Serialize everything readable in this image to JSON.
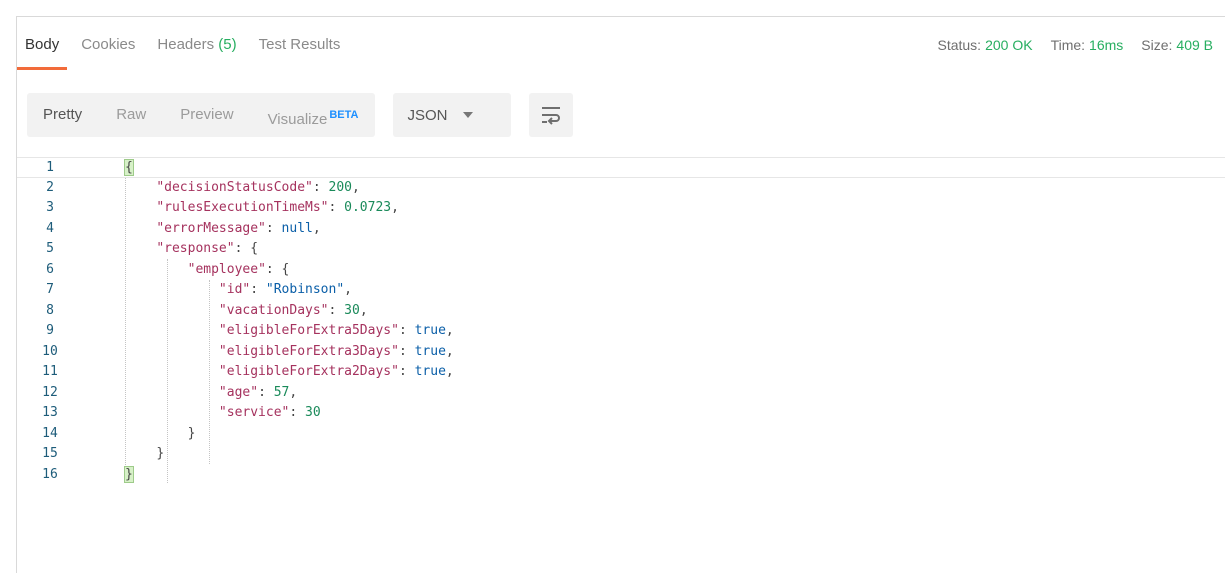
{
  "tabs": [
    {
      "label": "Body",
      "count": ""
    },
    {
      "label": "Cookies",
      "count": ""
    },
    {
      "label": "Headers",
      "count": "(5)"
    },
    {
      "label": "Test Results",
      "count": ""
    }
  ],
  "status": {
    "status_label": "Status:",
    "status_value": "200 OK",
    "time_label": "Time:",
    "time_value": "16ms",
    "size_label": "Size:",
    "size_value": "409 B"
  },
  "toolbar": {
    "pretty": "Pretty",
    "raw": "Raw",
    "preview": "Preview",
    "visualize": "Visualize",
    "beta": "BETA",
    "format": "JSON"
  },
  "code_lines": [
    {
      "num": "1"
    },
    {
      "num": "2"
    },
    {
      "num": "3"
    },
    {
      "num": "4"
    },
    {
      "num": "5"
    },
    {
      "num": "6"
    },
    {
      "num": "7"
    },
    {
      "num": "8"
    },
    {
      "num": "9"
    },
    {
      "num": "10"
    },
    {
      "num": "11"
    },
    {
      "num": "12"
    },
    {
      "num": "13"
    },
    {
      "num": "14"
    },
    {
      "num": "15"
    },
    {
      "num": "16"
    }
  ],
  "json": {
    "open": "{",
    "k1": "\"decisionStatusCode\"",
    "v1": "200",
    "k2": "\"rulesExecutionTimeMs\"",
    "v2": "0.0723",
    "k3": "\"errorMessage\"",
    "v3": "null",
    "k4": "\"response\"",
    "k5": "\"employee\"",
    "k6": "\"id\"",
    "v6": "\"Robinson\"",
    "k7": "\"vacationDays\"",
    "v7": "30",
    "k8": "\"eligibleForExtra5Days\"",
    "v8": "true",
    "k9": "\"eligibleForExtra3Days\"",
    "v9": "true",
    "k10": "\"eligibleForExtra2Days\"",
    "v10": "true",
    "k11": "\"age\"",
    "v11": "57",
    "k12": "\"service\"",
    "v12": "30",
    "close": "}"
  },
  "colors": {
    "accent": "#f26b3a",
    "ok": "#27ae60",
    "beta": "#1e90ff"
  }
}
